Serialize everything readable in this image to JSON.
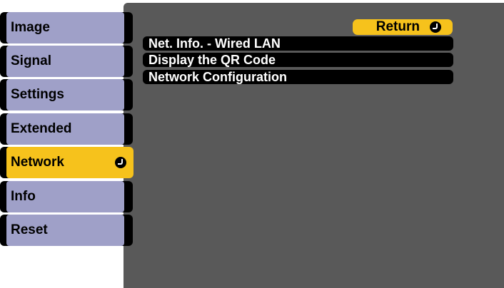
{
  "sidebar": {
    "items": [
      {
        "label": "Image"
      },
      {
        "label": "Signal"
      },
      {
        "label": "Settings"
      },
      {
        "label": "Extended"
      },
      {
        "label": "Network",
        "selected": true,
        "icon": "enter-icon"
      },
      {
        "label": "Info"
      },
      {
        "label": "Reset"
      }
    ]
  },
  "panel": {
    "return_label": "Return",
    "return_icon": "enter-icon",
    "menu_items": [
      {
        "label": "Net. Info. - Wired LAN"
      },
      {
        "label": "Display the QR Code"
      },
      {
        "label": "Network Configuration"
      }
    ]
  },
  "colors": {
    "tab": "#9fa0c8",
    "active": "#f6c21c",
    "panel": "#595959",
    "menu_row": "#000000"
  }
}
